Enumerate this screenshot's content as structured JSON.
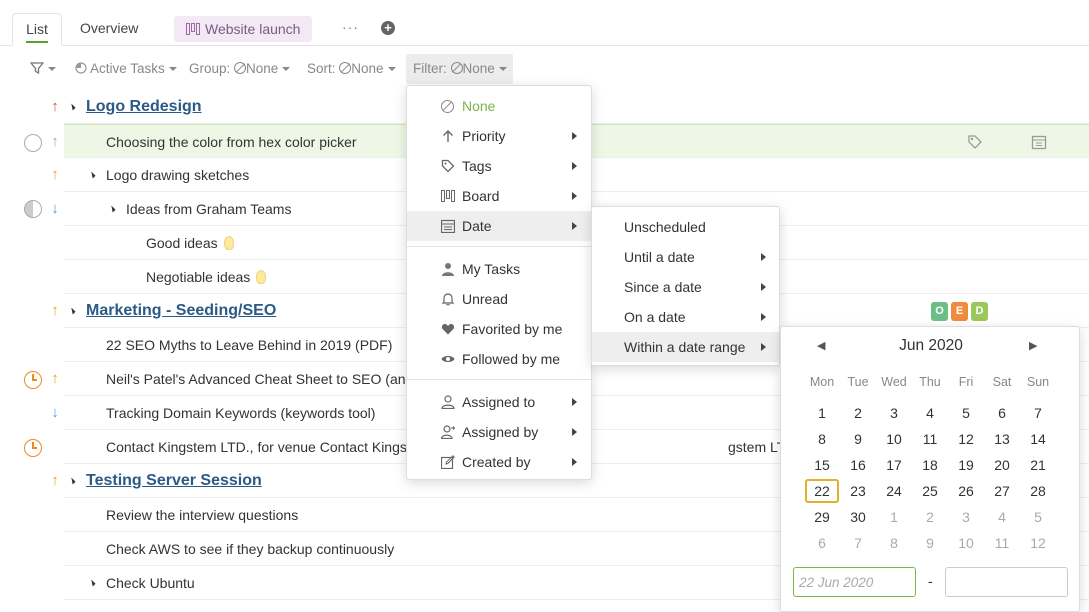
{
  "tabs": {
    "list": "List",
    "overview": "Overview",
    "board": "Website launch",
    "more": "···"
  },
  "toolbar": {
    "active_tasks": "Active Tasks",
    "group_label": "Group:",
    "group_value": "None",
    "sort_label": "Sort:",
    "sort_value": "None",
    "filter_label": "Filter:",
    "filter_value": "None"
  },
  "tasks": [
    {
      "title": "Logo Redesign",
      "type": "header",
      "priority": "up-red"
    },
    {
      "title": "Choosing the color from hex color picker",
      "status": "empty",
      "priority": "up-gray",
      "highlighted": true
    },
    {
      "title": "Logo drawing sketches",
      "priority": "up-orange"
    },
    {
      "title": "Ideas from Graham Teams",
      "status": "half",
      "priority": "down-blue"
    },
    {
      "title": "Good ideas"
    },
    {
      "title": "Negotiable ideas"
    },
    {
      "title": "Marketing - Seeding/SEO",
      "type": "header",
      "priority": "up-orange"
    },
    {
      "title": "22 SEO Myths to Leave Behind in 2019 (PDF)"
    },
    {
      "title": "Neil's Patel's Advanced Cheat Sheet to SEO (and",
      "status": "clock",
      "priority": "up-orange"
    },
    {
      "title": "Tracking Domain Keywords (keywords tool)",
      "priority": "down-blue"
    },
    {
      "title": "Contact Kingstem LTD., for venue Contact Kingst",
      "title_tail": "gstem LTD., for venue",
      "status": "clock"
    },
    {
      "title": "Testing Server Session",
      "type": "header",
      "priority": "up-orange"
    },
    {
      "title": "Review the interview questions"
    },
    {
      "title": "Check AWS to see if they backup continuously"
    },
    {
      "title": "Check Ubuntu"
    }
  ],
  "badges": [
    {
      "letter": "O",
      "color": "#6cbf84"
    },
    {
      "letter": "E",
      "color": "#f08a3c"
    },
    {
      "letter": "D",
      "color": "#9bc85a"
    }
  ],
  "filter_menu": {
    "none": "None",
    "priority": "Priority",
    "tags": "Tags",
    "board": "Board",
    "date": "Date",
    "my_tasks": "My Tasks",
    "unread": "Unread",
    "favorited": "Favorited by me",
    "followed": "Followed by me",
    "assigned_to": "Assigned to",
    "assigned_by": "Assigned by",
    "created_by": "Created by"
  },
  "date_submenu": {
    "unscheduled": "Unscheduled",
    "until": "Until a date",
    "since": "Since a date",
    "on": "On a date",
    "range": "Within a date range"
  },
  "calendar": {
    "month": "Jun 2020",
    "prev": "◀",
    "next": "▶",
    "weekdays": [
      "Mon",
      "Tue",
      "Wed",
      "Thu",
      "Fri",
      "Sat",
      "Sun"
    ],
    "weeks": [
      [
        1,
        2,
        3,
        4,
        5,
        6,
        7
      ],
      [
        8,
        9,
        10,
        11,
        12,
        13,
        14
      ],
      [
        15,
        16,
        17,
        18,
        19,
        20,
        21
      ],
      [
        22,
        23,
        24,
        25,
        26,
        27,
        28
      ],
      [
        29,
        30,
        1,
        2,
        3,
        4,
        5
      ],
      [
        6,
        7,
        8,
        9,
        10,
        11,
        12
      ]
    ],
    "today": 22,
    "from_placeholder": "22 Jun 2020",
    "to_value": "",
    "dash": "-"
  }
}
